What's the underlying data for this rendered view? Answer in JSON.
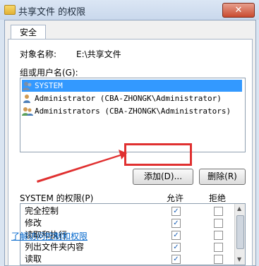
{
  "window": {
    "title": "共享文件 的权限",
    "close_label": "✕"
  },
  "tabs": [
    {
      "label": "安全"
    }
  ],
  "object": {
    "label": "对象名称:",
    "value": "E:\\共享文件"
  },
  "groups": {
    "label": "组或用户名(G):",
    "items": [
      {
        "name": "SYSTEM",
        "selected": true
      },
      {
        "name": "Administrator (CBA-ZHONGK\\Administrator)",
        "selected": false
      },
      {
        "name": "Administrators (CBA-ZHONGK\\Administrators)",
        "selected": false
      }
    ]
  },
  "buttons": {
    "add": "添加(D)...",
    "remove": "删除(R)"
  },
  "permissions": {
    "title": "SYSTEM 的权限(P)",
    "allow_label": "允许",
    "deny_label": "拒绝",
    "rows": [
      {
        "name": "完全控制",
        "allow": true,
        "deny": false
      },
      {
        "name": "修改",
        "allow": true,
        "deny": false
      },
      {
        "name": "读取和执行",
        "allow": true,
        "deny": false
      },
      {
        "name": "列出文件夹内容",
        "allow": true,
        "deny": false
      },
      {
        "name": "读取",
        "allow": true,
        "deny": false
      }
    ]
  },
  "link": {
    "text": "了解访问控制和权限"
  },
  "colors": {
    "selection": "#3399ff",
    "annotation": "#e03030",
    "link": "#0066cc"
  }
}
